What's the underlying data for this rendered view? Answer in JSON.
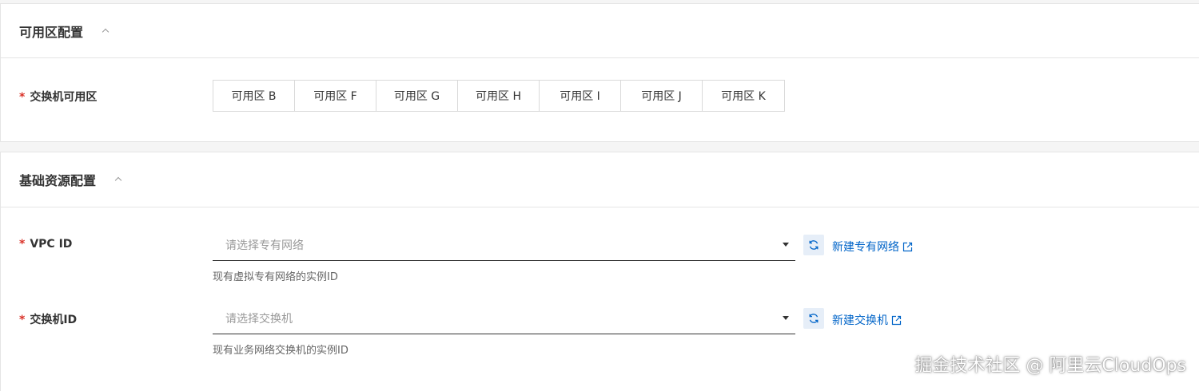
{
  "zone_section": {
    "title": "可用区配置",
    "switch_zone_label": "交换机可用区",
    "required_mark": "*",
    "zones": [
      "可用区 B",
      "可用区 F",
      "可用区 G",
      "可用区 H",
      "可用区 I",
      "可用区 J",
      "可用区 K"
    ]
  },
  "resource_section": {
    "title": "基础资源配置",
    "vpc": {
      "label": "VPC ID",
      "placeholder": "请选择专有网络",
      "create_link": "新建专有网络",
      "help": "现有虚拟专有网络的实例ID"
    },
    "vswitch": {
      "label": "交换机ID",
      "placeholder": "请选择交换机",
      "create_link": "新建交换机",
      "help": "现有业务网络交换机的实例ID"
    }
  },
  "watermark": "掘金技术社区 @ 阿里云CloudOps",
  "colors": {
    "accent": "#0064c8",
    "required": "#d93026",
    "border": "#e5e5e5"
  }
}
